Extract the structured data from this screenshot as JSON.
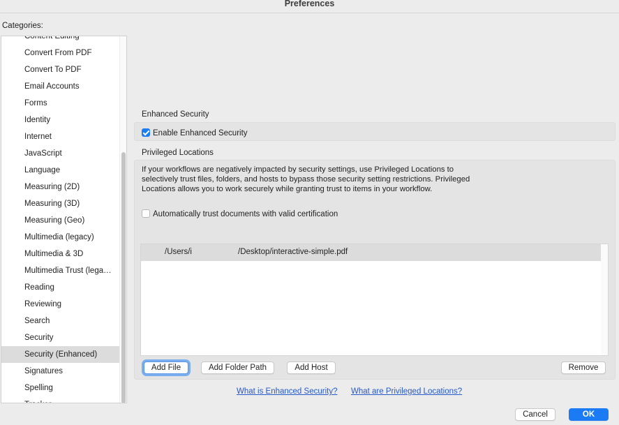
{
  "window": {
    "title": "Preferences"
  },
  "sidebar": {
    "label": "Categories:",
    "items": [
      "Content Editing",
      "Convert From PDF",
      "Convert To PDF",
      "Email Accounts",
      "Forms",
      "Identity",
      "Internet",
      "JavaScript",
      "Language",
      "Measuring (2D)",
      "Measuring (3D)",
      "Measuring (Geo)",
      "Multimedia (legacy)",
      "Multimedia & 3D",
      "Multimedia Trust (lega…",
      "Reading",
      "Reviewing",
      "Search",
      "Security",
      "Security (Enhanced)",
      "Signatures",
      "Spelling",
      "Tracker"
    ],
    "selected": "Security (Enhanced)"
  },
  "enhanced_security": {
    "title": "Enhanced Security",
    "checkbox_label": "Enable Enhanced Security",
    "checked": true
  },
  "privileged_locations": {
    "title": "Privileged Locations",
    "description": "If your workflows are negatively impacted by security settings, use Privileged Locations to selectively trust files, folders, and hosts to bypass those security setting restrictions. Privileged Locations allows you to work securely while granting trust to items in your workflow.",
    "auto_trust_label": "Automatically trust documents with valid certification",
    "auto_trust_checked": false,
    "locations": [
      {
        "path_start": "/Users/i",
        "path_end": "/Desktop/interactive-simple.pdf"
      }
    ],
    "buttons": {
      "add_file": "Add File",
      "add_folder_path": "Add Folder Path",
      "add_host": "Add Host",
      "remove": "Remove"
    }
  },
  "links": {
    "what_is_enhanced": "What is Enhanced Security?",
    "what_are_privileged": "What are Privileged Locations?"
  },
  "footer": {
    "cancel": "Cancel",
    "ok": "OK"
  }
}
